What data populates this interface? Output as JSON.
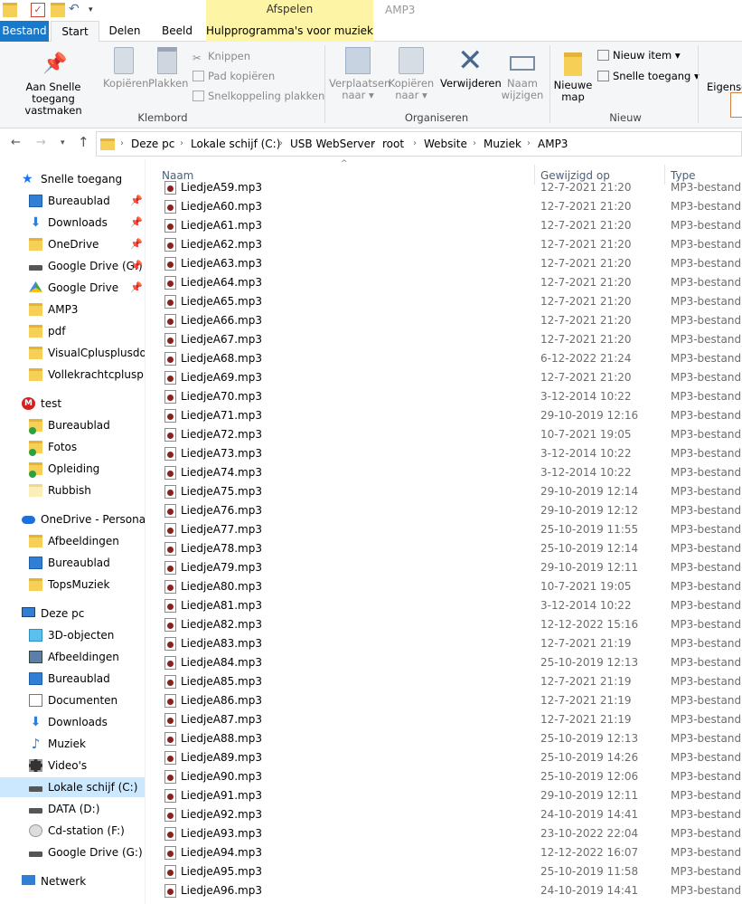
{
  "window": {
    "title": "AMP3",
    "context_tab_group": "Afspelen"
  },
  "tabs": {
    "bestand": "Bestand",
    "start": "Start",
    "delen": "Delen",
    "beeld": "Beeld",
    "muziek": "Hulpprogramma's voor muziek"
  },
  "ribbon": {
    "pin_label1": "Aan Snelle toegang",
    "pin_label2": "vastmaken",
    "copy": "Kopiëren",
    "paste": "Plakken",
    "cut": "Knippen",
    "copy_path": "Pad kopiëren",
    "paste_shortcut": "Snelkoppeling plakken",
    "group_clipboard": "Klembord",
    "move_to1": "Verplaatsen",
    "move_to2": "naar ▾",
    "copy_to1": "Kopiëren",
    "copy_to2": "naar ▾",
    "delete": "Verwijderen",
    "rename1": "Naam",
    "rename2": "wijzigen",
    "group_organize": "Organiseren",
    "new_folder1": "Nieuwe",
    "new_folder2": "map",
    "new_item": "Nieuw item ▾",
    "quick_access": "Snelle toegang ▾",
    "group_new": "Nieuw",
    "properties": "Eigensc"
  },
  "address": {
    "crumbs": [
      "Deze pc",
      "Lokale schijf (C:)",
      "USB WebServer",
      "root",
      "Website",
      "Muziek",
      "AMP3"
    ]
  },
  "columns": {
    "name": "Naam",
    "modified": "Gewijzigd op",
    "type": "Type"
  },
  "sidebar": [
    {
      "label": "Snelle toegang",
      "icon": "star-icon",
      "group": true
    },
    {
      "label": "Bureaublad",
      "icon": "desktop-icon",
      "pin": true
    },
    {
      "label": "Downloads",
      "icon": "downloads-icon",
      "pin": true
    },
    {
      "label": "OneDrive",
      "icon": "folder-icon",
      "pin": true
    },
    {
      "label": "Google Drive (G:)",
      "icon": "drive-icon",
      "pin": true
    },
    {
      "label": "Google Drive",
      "icon": "google-drive-icon",
      "pin": true
    },
    {
      "label": "AMP3",
      "icon": "folder-icon"
    },
    {
      "label": "pdf",
      "icon": "folder-icon"
    },
    {
      "label": "VisualCplusplusdotr",
      "icon": "folder-icon"
    },
    {
      "label": "Vollekrachtcplusplus",
      "icon": "folder-icon"
    },
    {
      "label": "test",
      "icon": "mega-icon",
      "group": true
    },
    {
      "label": "Bureaublad",
      "icon": "folder-sync-icon"
    },
    {
      "label": "Fotos",
      "icon": "folder-sync-icon"
    },
    {
      "label": "Opleiding",
      "icon": "folder-sync-icon"
    },
    {
      "label": "Rubbish",
      "icon": "folder-pale-icon"
    },
    {
      "label": "OneDrive - Personal",
      "icon": "cloud-icon",
      "group": true
    },
    {
      "label": "Afbeeldingen",
      "icon": "folder-icon"
    },
    {
      "label": "Bureaublad",
      "icon": "desktop-icon"
    },
    {
      "label": "TopsMuziek",
      "icon": "folder-icon"
    },
    {
      "label": "Deze pc",
      "icon": "pc-icon",
      "group": true
    },
    {
      "label": "3D-objecten",
      "icon": "3d-objects-icon"
    },
    {
      "label": "Afbeeldingen",
      "icon": "pictures-icon"
    },
    {
      "label": "Bureaublad",
      "icon": "desktop-icon"
    },
    {
      "label": "Documenten",
      "icon": "documents-icon"
    },
    {
      "label": "Downloads",
      "icon": "downloads-icon"
    },
    {
      "label": "Muziek",
      "icon": "music-icon"
    },
    {
      "label": "Video's",
      "icon": "video-icon"
    },
    {
      "label": "Lokale schijf (C:)",
      "icon": "drive-icon",
      "selected": true
    },
    {
      "label": "DATA (D:)",
      "icon": "drive-icon"
    },
    {
      "label": "Cd-station (F:)",
      "icon": "cd-icon"
    },
    {
      "label": "Google Drive (G:)",
      "icon": "drive-icon"
    },
    {
      "label": "Netwerk",
      "icon": "network-icon",
      "group": true
    }
  ],
  "files": [
    {
      "name": "LiedjeA59.mp3",
      "date": "12-7-2021 21:20",
      "type": "MP3-bestand"
    },
    {
      "name": "LiedjeA60.mp3",
      "date": "12-7-2021 21:20",
      "type": "MP3-bestand"
    },
    {
      "name": "LiedjeA61.mp3",
      "date": "12-7-2021 21:20",
      "type": "MP3-bestand"
    },
    {
      "name": "LiedjeA62.mp3",
      "date": "12-7-2021 21:20",
      "type": "MP3-bestand"
    },
    {
      "name": "LiedjeA63.mp3",
      "date": "12-7-2021 21:20",
      "type": "MP3-bestand"
    },
    {
      "name": "LiedjeA64.mp3",
      "date": "12-7-2021 21:20",
      "type": "MP3-bestand"
    },
    {
      "name": "LiedjeA65.mp3",
      "date": "12-7-2021 21:20",
      "type": "MP3-bestand"
    },
    {
      "name": "LiedjeA66.mp3",
      "date": "12-7-2021 21:20",
      "type": "MP3-bestand"
    },
    {
      "name": "LiedjeA67.mp3",
      "date": "12-7-2021 21:20",
      "type": "MP3-bestand"
    },
    {
      "name": "LiedjeA68.mp3",
      "date": "6-12-2022 21:24",
      "type": "MP3-bestand"
    },
    {
      "name": "LiedjeA69.mp3",
      "date": "12-7-2021 21:20",
      "type": "MP3-bestand"
    },
    {
      "name": "LiedjeA70.mp3",
      "date": "3-12-2014 10:22",
      "type": "MP3-bestand"
    },
    {
      "name": "LiedjeA71.mp3",
      "date": "29-10-2019 12:16",
      "type": "MP3-bestand"
    },
    {
      "name": "LiedjeA72.mp3",
      "date": "10-7-2021 19:05",
      "type": "MP3-bestand"
    },
    {
      "name": "LiedjeA73.mp3",
      "date": "3-12-2014 10:22",
      "type": "MP3-bestand"
    },
    {
      "name": "LiedjeA74.mp3",
      "date": "3-12-2014 10:22",
      "type": "MP3-bestand"
    },
    {
      "name": "LiedjeA75.mp3",
      "date": "29-10-2019 12:14",
      "type": "MP3-bestand"
    },
    {
      "name": "LiedjeA76.mp3",
      "date": "29-10-2019 12:12",
      "type": "MP3-bestand"
    },
    {
      "name": "LiedjeA77.mp3",
      "date": "25-10-2019 11:55",
      "type": "MP3-bestand"
    },
    {
      "name": "LiedjeA78.mp3",
      "date": "25-10-2019 12:14",
      "type": "MP3-bestand"
    },
    {
      "name": "LiedjeA79.mp3",
      "date": "29-10-2019 12:11",
      "type": "MP3-bestand"
    },
    {
      "name": "LiedjeA80.mp3",
      "date": "10-7-2021 19:05",
      "type": "MP3-bestand"
    },
    {
      "name": "LiedjeA81.mp3",
      "date": "3-12-2014 10:22",
      "type": "MP3-bestand"
    },
    {
      "name": "LiedjeA82.mp3",
      "date": "12-12-2022 15:16",
      "type": "MP3-bestand"
    },
    {
      "name": "LiedjeA83.mp3",
      "date": "12-7-2021 21:19",
      "type": "MP3-bestand"
    },
    {
      "name": "LiedjeA84.mp3",
      "date": "25-10-2019 12:13",
      "type": "MP3-bestand"
    },
    {
      "name": "LiedjeA85.mp3",
      "date": "12-7-2021 21:19",
      "type": "MP3-bestand"
    },
    {
      "name": "LiedjeA86.mp3",
      "date": "12-7-2021 21:19",
      "type": "MP3-bestand"
    },
    {
      "name": "LiedjeA87.mp3",
      "date": "12-7-2021 21:19",
      "type": "MP3-bestand"
    },
    {
      "name": "LiedjeA88.mp3",
      "date": "25-10-2019 12:13",
      "type": "MP3-bestand"
    },
    {
      "name": "LiedjeA89.mp3",
      "date": "25-10-2019 14:26",
      "type": "MP3-bestand"
    },
    {
      "name": "LiedjeA90.mp3",
      "date": "25-10-2019 12:06",
      "type": "MP3-bestand"
    },
    {
      "name": "LiedjeA91.mp3",
      "date": "29-10-2019 12:11",
      "type": "MP3-bestand"
    },
    {
      "name": "LiedjeA92.mp3",
      "date": "24-10-2019 14:41",
      "type": "MP3-bestand"
    },
    {
      "name": "LiedjeA93.mp3",
      "date": "23-10-2022 22:04",
      "type": "MP3-bestand"
    },
    {
      "name": "LiedjeA94.mp3",
      "date": "12-12-2022 16:07",
      "type": "MP3-bestand"
    },
    {
      "name": "LiedjeA95.mp3",
      "date": "25-10-2019 11:58",
      "type": "MP3-bestand"
    },
    {
      "name": "LiedjeA96.mp3",
      "date": "24-10-2019 14:41",
      "type": "MP3-bestand"
    }
  ]
}
